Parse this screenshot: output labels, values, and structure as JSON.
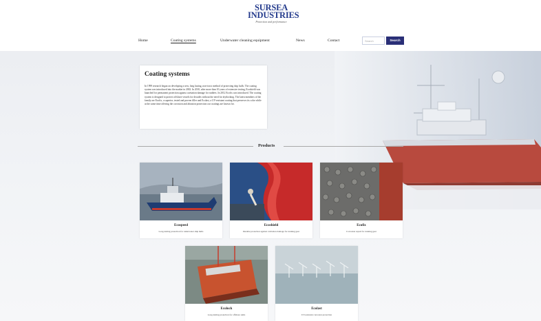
{
  "brand": {
    "line1": "SURSEA",
    "line2": "INDUSTRIES",
    "tagline": "Protection and performance"
  },
  "nav": {
    "items": [
      {
        "label": "Home"
      },
      {
        "label": "Coating systems"
      },
      {
        "label": "Underwater cleaning equipment"
      },
      {
        "label": "News"
      },
      {
        "label": "Contact"
      }
    ],
    "active": "Coating systems"
  },
  "search": {
    "placeholder": "Search",
    "button_label": "Search"
  },
  "intro": {
    "title": "Coating systems",
    "body": "In 1999 research began on developing a new, long lasting, non-toxic method of protecting ship hulls. The coating system was introduced into the market in 2002. In 2010, after more than 10 years of extensive testing, Ecoshield was launched for permanent protection against cavitation damage for rudders. In 2012 Ecofix was introduced. The coating system is designed to protect offshore vessels for decades without the need for drydocking. The latest members of the family are Ecofix, a superior, tested and proven filler and Ecolast, a UV-resistant coating that preserves its color while at the same time offering the corrosion and abrasion protection our coatings are known for."
  },
  "products": {
    "heading": "Products",
    "items": [
      {
        "name": "Ecospeed",
        "desc": "Long-lasting protection for underwater ship hulls"
      },
      {
        "name": "Ecoshield",
        "desc": "Durable protection against cavitation damage for running gear"
      },
      {
        "name": "Ecofix",
        "desc": "Corrosion repair for running gear"
      },
      {
        "name": "Ecolock",
        "desc": "Long-lasting protection for offshore units"
      },
      {
        "name": "Ecolast",
        "desc": "UV-resistant corrosion protection"
      }
    ]
  },
  "colors": {
    "brand_blue": "#233a8c",
    "search_button": "#2a2f77",
    "hull_red": "#b84a3e"
  }
}
